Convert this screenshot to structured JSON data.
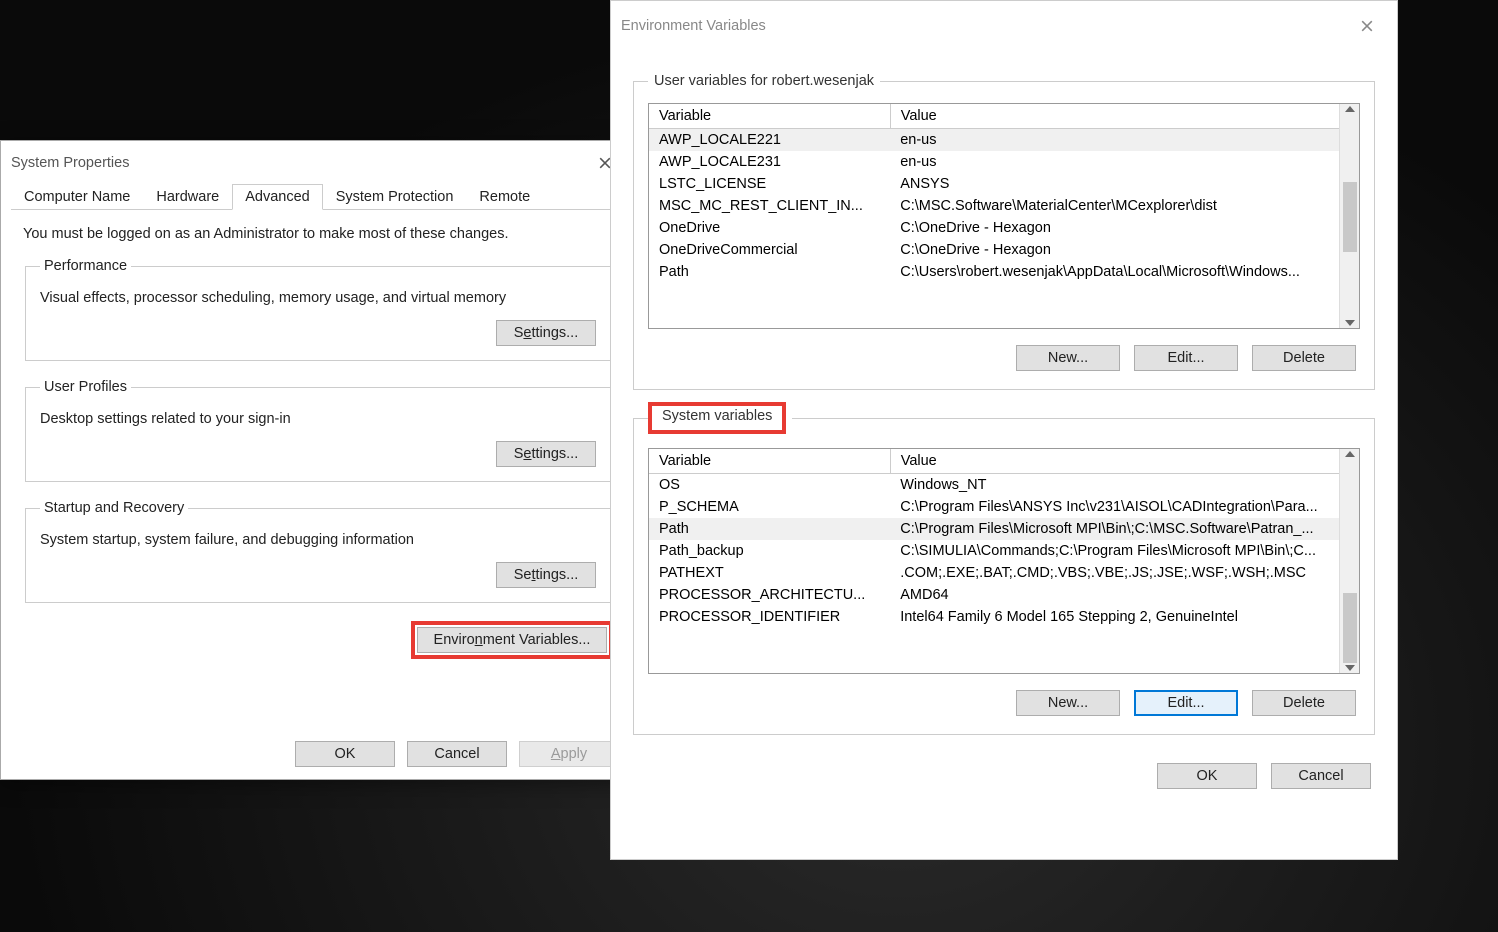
{
  "sys": {
    "title": "System Properties",
    "tabs": {
      "computer_name": "Computer Name",
      "hardware": "Hardware",
      "advanced": "Advanced",
      "system_protection": "System Protection",
      "remote": "Remote"
    },
    "admin_note": "You must be logged on as an Administrator to make most of these changes.",
    "perf": {
      "legend": "Performance",
      "desc": "Visual effects, processor scheduling, memory usage, and virtual memory",
      "settings": "Settings..."
    },
    "profiles": {
      "legend": "User Profiles",
      "desc": "Desktop settings related to your sign-in",
      "settings": "Settings..."
    },
    "startup": {
      "legend": "Startup and Recovery",
      "desc": "System startup, system failure, and debugging information",
      "settings": "Settings..."
    },
    "env_button": "Environment Variables...",
    "ok": "OK",
    "cancel": "Cancel",
    "apply": "Apply"
  },
  "env": {
    "title": "Environment Variables",
    "user_legend": "User variables for robert.wesenjak",
    "sys_legend": "System variables",
    "hdr_var": "Variable",
    "hdr_val": "Value",
    "user_vars": [
      {
        "name": "AWP_LOCALE221",
        "value": "en-us"
      },
      {
        "name": "AWP_LOCALE231",
        "value": "en-us"
      },
      {
        "name": "LSTC_LICENSE",
        "value": "ANSYS"
      },
      {
        "name": "MSC_MC_REST_CLIENT_IN...",
        "value": "C:\\MSC.Software\\MaterialCenter\\MCexplorer\\dist"
      },
      {
        "name": "OneDrive",
        "value": "C:\\OneDrive - Hexagon"
      },
      {
        "name": "OneDriveCommercial",
        "value": "C:\\OneDrive - Hexagon"
      },
      {
        "name": "Path",
        "value": "C:\\Users\\robert.wesenjak\\AppData\\Local\\Microsoft\\Windows..."
      }
    ],
    "sys_vars": [
      {
        "name": "OS",
        "value": "Windows_NT"
      },
      {
        "name": "P_SCHEMA",
        "value": "C:\\Program Files\\ANSYS Inc\\v231\\AISOL\\CADIntegration\\Para..."
      },
      {
        "name": "Path",
        "value": "C:\\Program Files\\Microsoft MPI\\Bin\\;C:\\MSC.Software\\Patran_..."
      },
      {
        "name": "Path_backup",
        "value": "C:\\SIMULIA\\Commands;C:\\Program Files\\Microsoft MPI\\Bin\\;C..."
      },
      {
        "name": "PATHEXT",
        "value": ".COM;.EXE;.BAT;.CMD;.VBS;.VBE;.JS;.JSE;.WSF;.WSH;.MSC"
      },
      {
        "name": "PROCESSOR_ARCHITECTU...",
        "value": "AMD64"
      },
      {
        "name": "PROCESSOR_IDENTIFIER",
        "value": "Intel64 Family 6 Model 165 Stepping 2, GenuineIntel"
      }
    ],
    "user_selected": 0,
    "sys_selected": 2,
    "new": "New...",
    "edit": "Edit...",
    "delete": "Delete",
    "ok": "OK",
    "cancel": "Cancel"
  }
}
